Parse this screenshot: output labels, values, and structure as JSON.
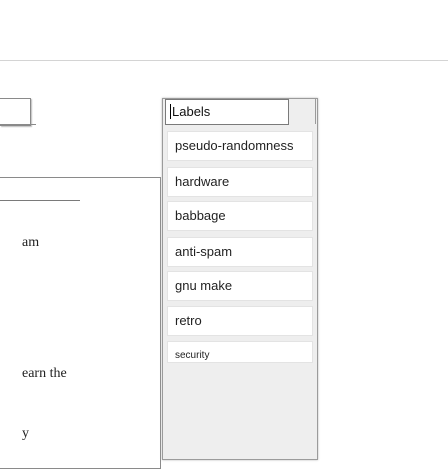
{
  "background": {
    "fragments": [
      "am",
      "earn the",
      "y"
    ]
  },
  "labels_popup": {
    "search_value": "Labels",
    "items": [
      "pseudo-randomness",
      "hardware",
      "babbage",
      "anti-spam",
      "gnu make",
      "retro",
      "security"
    ]
  }
}
